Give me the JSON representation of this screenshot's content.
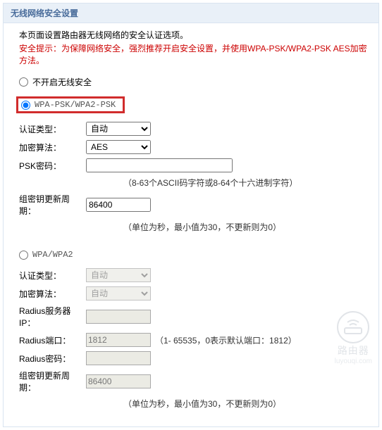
{
  "header": {
    "title": "无线网络安全设置"
  },
  "intro": {
    "desc": "本页面设置路由器无线网络的安全认证选项。",
    "warning": "安全提示：为保障网络安全，强烈推荐开启安全设置，并使用WPA-PSK/WPA2-PSK AES加密方法。"
  },
  "modes": {
    "disabled_label": "不开启无线安全",
    "wpapsk_label": "WPA-PSK/WPA2-PSK",
    "wpa_label": "WPA/WPA2"
  },
  "wpapsk": {
    "auth_label": "认证类型：",
    "auth_value": "自动",
    "cipher_label": "加密算法：",
    "cipher_value": "AES",
    "psk_label": "PSK密码：",
    "psk_value": "",
    "psk_hint": "（8-63个ASCII码字符或8-64个十六进制字符）",
    "rekey_label": "组密钥更新周期：",
    "rekey_value": "86400",
    "rekey_hint": "（单位为秒，最小值为30，不更新则为0）"
  },
  "wpa": {
    "auth_label": "认证类型：",
    "auth_value": "自动",
    "cipher_label": "加密算法：",
    "cipher_value": "自动",
    "radius_ip_label": "Radius服务器IP：",
    "radius_ip_value": "",
    "radius_port_label": "Radius端口：",
    "radius_port_value": "1812",
    "radius_port_hint": "（1- 65535，0表示默认端口：1812）",
    "radius_pwd_label": "Radius密码：",
    "radius_pwd_value": "",
    "rekey_label": "组密钥更新周期：",
    "rekey_value": "86400",
    "rekey_hint": "（单位为秒，最小值为30，不更新则为0）"
  },
  "watermark": {
    "text": "路由器",
    "sub": "luyouqi.com"
  }
}
